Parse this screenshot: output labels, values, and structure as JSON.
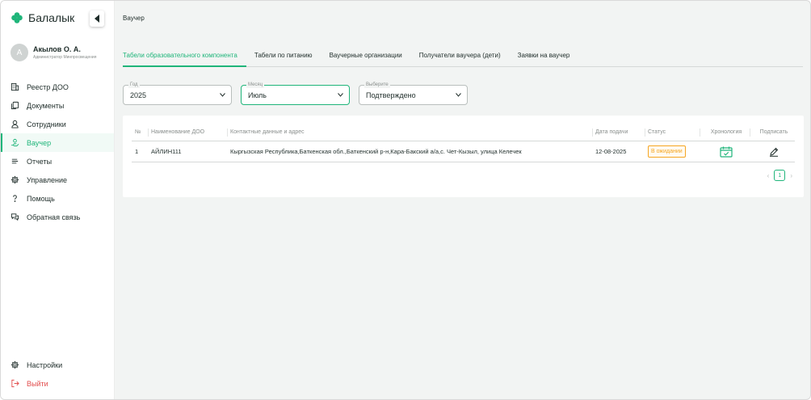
{
  "brand": {
    "name": "Балалык"
  },
  "user": {
    "initial": "А",
    "name": "Акылов О. А.",
    "role": "Администратор Минпросвещения"
  },
  "sidebar": {
    "items": [
      {
        "label": "Реестр ДОО",
        "icon": "building-icon"
      },
      {
        "label": "Документы",
        "icon": "documents-icon"
      },
      {
        "label": "Сотрудники",
        "icon": "user-icon"
      },
      {
        "label": "Ваучер",
        "icon": "voucher-hand-icon",
        "active": true
      },
      {
        "label": "Отчеты",
        "icon": "list-icon"
      },
      {
        "label": "Управление",
        "icon": "gear-icon"
      },
      {
        "label": "Помощь",
        "icon": "question-icon"
      },
      {
        "label": "Обратная связь",
        "icon": "chat-icon"
      }
    ],
    "bottom": [
      {
        "label": "Настройки",
        "icon": "settings-icon"
      },
      {
        "label": "Выйти",
        "icon": "logout-icon"
      }
    ]
  },
  "page": {
    "title": "Ваучер"
  },
  "tabs": [
    {
      "label": "Табели образовательного компонента",
      "active": true
    },
    {
      "label": "Табели по питанию"
    },
    {
      "label": "Ваучерные организации"
    },
    {
      "label": "Получатели ваучера (дети)"
    },
    {
      "label": "Заявки на ваучер"
    }
  ],
  "filters": {
    "year": {
      "label": "Год",
      "value": "2025"
    },
    "month": {
      "label": "Месяц",
      "value": "Июль"
    },
    "status": {
      "label": "Выберите",
      "value": "Подтверждено"
    }
  },
  "table": {
    "headers": {
      "num": "№",
      "name": "Наименование ДОО",
      "address": "Контактные данные и адрес",
      "date": "Дата подачи",
      "status": "Статус",
      "chronology": "Хронология",
      "sign": "Подписать"
    },
    "rows": [
      {
        "num": "1",
        "name": "АЙЛИН111",
        "address": "Кыргызская Республика,Баткенская обл.,Баткенский р-н,Кара-Бакский а/а,с. Чет-Кызыл, улица Келечек",
        "date": "12-08-2025",
        "status": "В ожидании"
      }
    ]
  },
  "pagination": {
    "current": "1",
    "prev": "‹",
    "next": "›"
  },
  "colors": {
    "accent": "#1fb57a",
    "warning": "#f5a623",
    "danger": "#e24c4c"
  }
}
